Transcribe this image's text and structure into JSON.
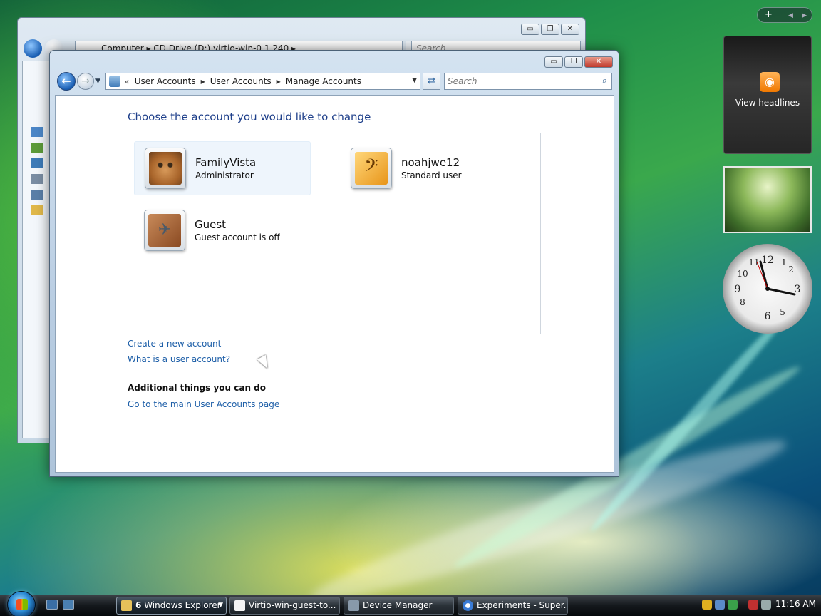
{
  "desktop": {
    "sidebar_add_label": "+",
    "rss_gadget_label": "View headlines"
  },
  "back_window": {
    "address_text": "Computer  ▸  CD Drive (D:) virtio-win-0.1.240  ▸",
    "search_placeholder": "Search"
  },
  "window": {
    "min_label": "▭",
    "max_label": "❐",
    "close_label": "✕"
  },
  "address_bar": {
    "crumbs": [
      "User Accounts",
      "User Accounts",
      "Manage Accounts"
    ],
    "search_placeholder": "Search"
  },
  "main": {
    "heading": "Choose the account you would like to change",
    "accounts": [
      {
        "name": "FamilyVista",
        "type": "Administrator",
        "picture": "cat-picture"
      },
      {
        "name": "noahjwe12",
        "type": "Standard user",
        "picture": "music-clef-picture"
      },
      {
        "name": "Guest",
        "type": "Guest account is off",
        "picture": "suitcase-picture"
      }
    ],
    "links": {
      "create_account": "Create a new account",
      "what_is_account": "What is a user account?"
    },
    "additional_heading": "Additional things you can do",
    "main_page_link": "Go to the main User Accounts page"
  },
  "taskbar": {
    "items": [
      {
        "count": "6",
        "label": "Windows Explorer"
      },
      {
        "label": "Virtio-win-guest-to..."
      },
      {
        "label": "Device Manager"
      },
      {
        "label": "Experiments - Super..."
      }
    ],
    "clock": "11:16 AM"
  },
  "colors": {
    "link": "#1e5fa8",
    "heading": "#1e3f8a",
    "selected_account_bg": "#eef5fc"
  }
}
